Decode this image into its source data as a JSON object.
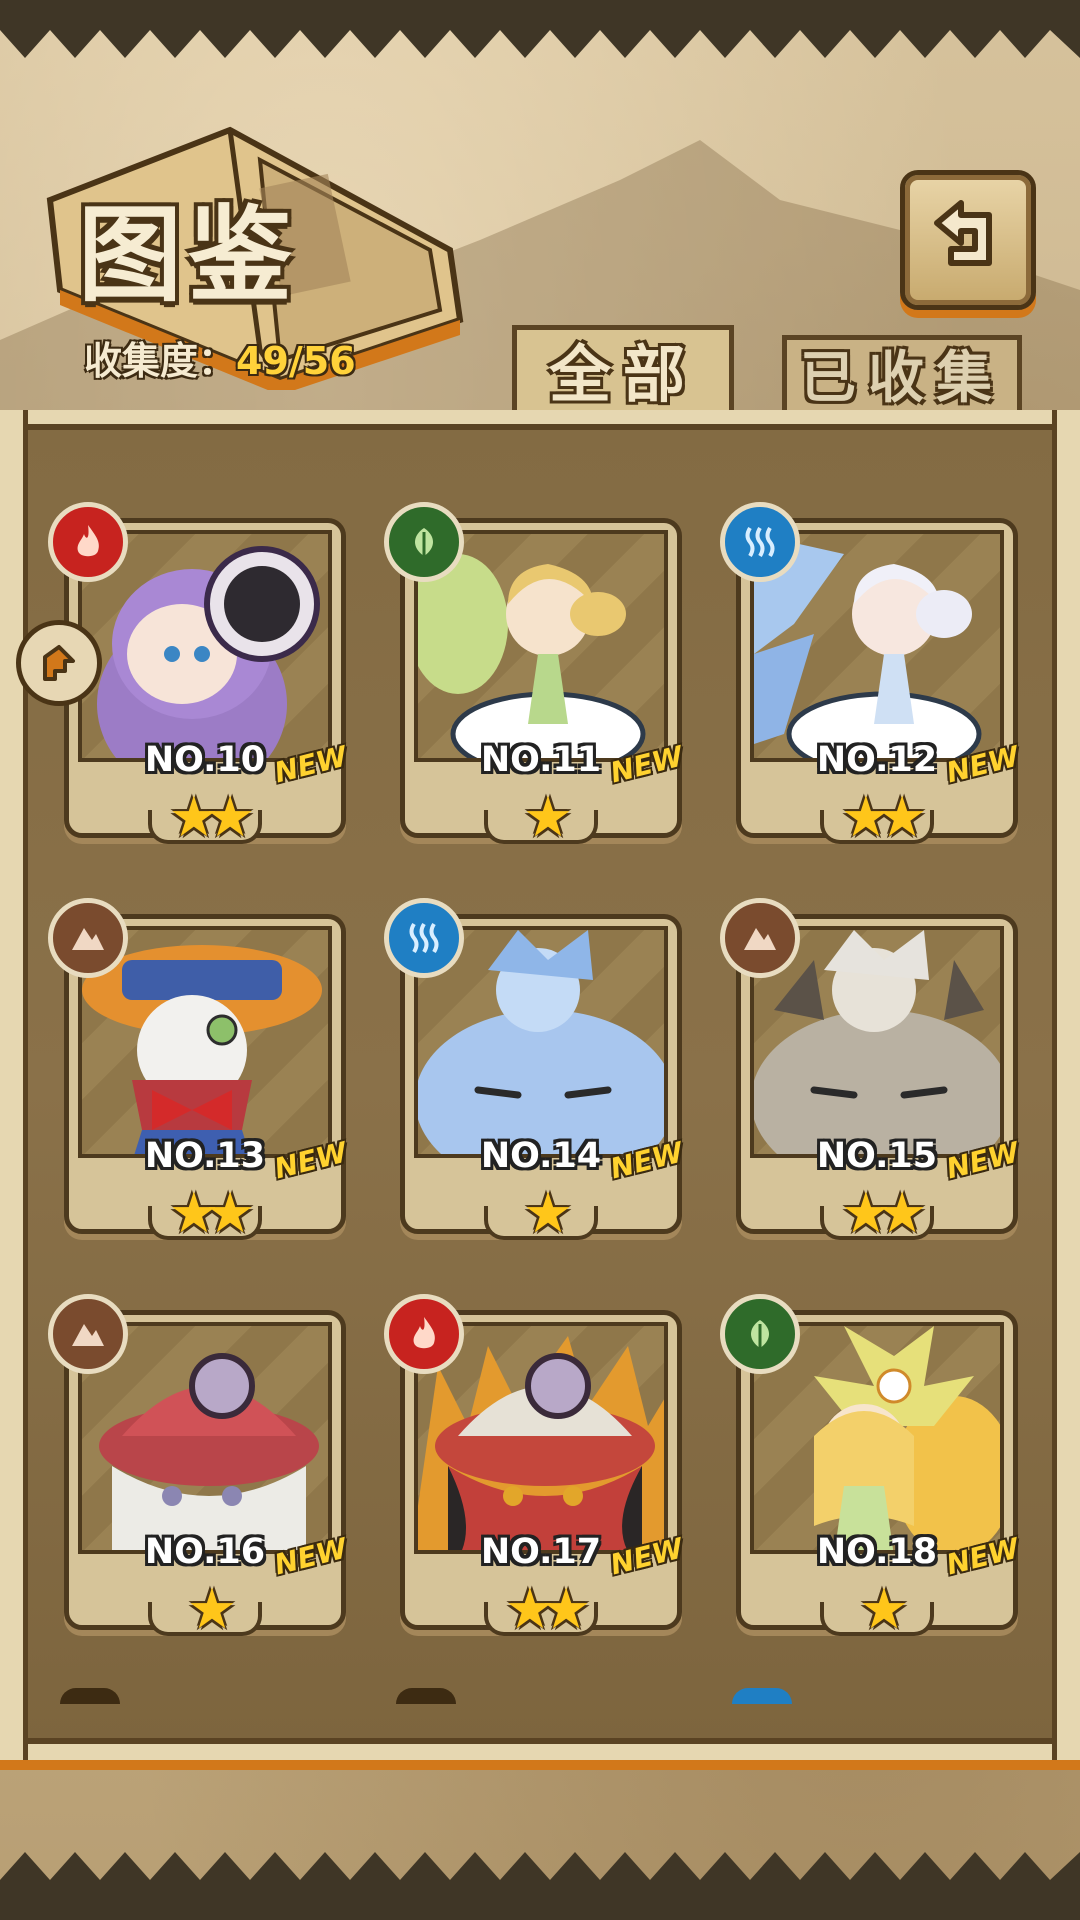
{
  "header": {
    "title": "图鉴",
    "collection_label": "收集度：",
    "collection_value": "49/56"
  },
  "tabs": [
    {
      "label": "全部",
      "active": true
    },
    {
      "label": "已收集",
      "active": false
    }
  ],
  "cards": [
    {
      "number": "NO.10",
      "badge": "NEW",
      "stars": "★★",
      "element": "fire-icon"
    },
    {
      "number": "NO.11",
      "badge": "NEW",
      "stars": "★",
      "element": "leaf-icon"
    },
    {
      "number": "NO.12",
      "badge": "NEW",
      "stars": "★★",
      "element": "water-icon"
    },
    {
      "number": "NO.13",
      "badge": "NEW",
      "stars": "★★",
      "element": "earth-icon"
    },
    {
      "number": "NO.14",
      "badge": "NEW",
      "stars": "★",
      "element": "water-icon"
    },
    {
      "number": "NO.15",
      "badge": "NEW",
      "stars": "★★",
      "element": "earth-icon"
    },
    {
      "number": "NO.16",
      "badge": "NEW",
      "stars": "★",
      "element": "earth-icon"
    },
    {
      "number": "NO.17",
      "badge": "NEW",
      "stars": "★★",
      "element": "fire-icon"
    },
    {
      "number": "NO.18",
      "badge": "NEW",
      "stars": "★",
      "element": "leaf-icon"
    }
  ],
  "colors": {
    "fire": "#c7231f",
    "leaf": "#2f6b2a",
    "water": "#1f7fc4",
    "earth": "#7a4b2e",
    "star": "#ffc61a",
    "new_badge": "#ffd22f",
    "collection_value": "#ffd23a"
  }
}
